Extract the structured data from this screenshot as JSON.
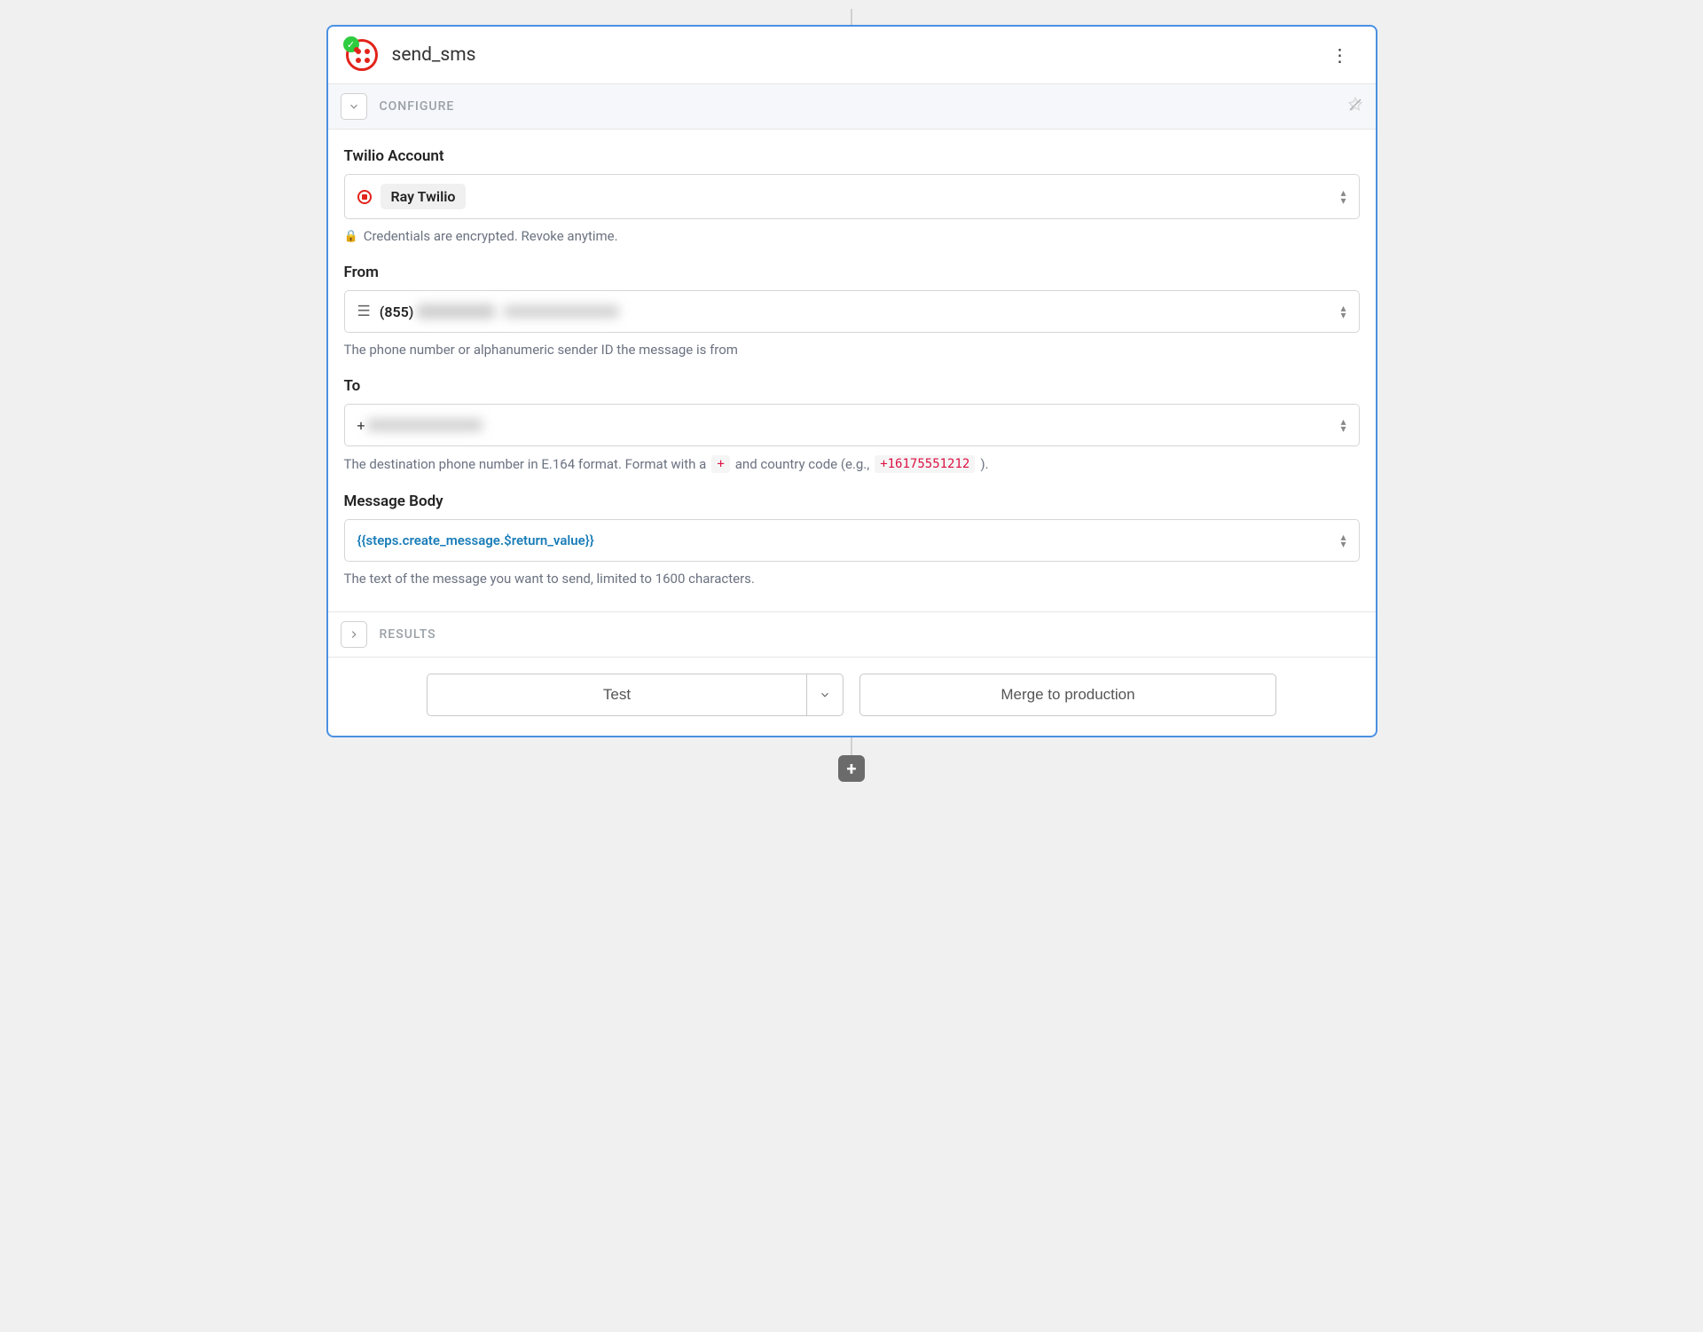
{
  "header": {
    "title": "send_sms"
  },
  "sections": {
    "configure": "CONFIGURE",
    "results": "RESULTS"
  },
  "fields": {
    "account": {
      "label": "Twilio Account",
      "value": "Ray Twilio",
      "helper": "Credentials are encrypted. Revoke anytime."
    },
    "from": {
      "label": "From",
      "prefix": "(855)",
      "helper": "The phone number or alphanumeric sender ID the message is from"
    },
    "to": {
      "label": "To",
      "prefix": "+",
      "helper_pre": "The destination phone number in E.164 format. Format with a",
      "helper_chip1": "+",
      "helper_mid": "and country code (e.g.,",
      "helper_chip2": "+16175551212",
      "helper_post": ")."
    },
    "body": {
      "label": "Message Body",
      "value": "{{steps.create_message.$return_value}}",
      "helper": "The text of the message you want to send, limited to 1600 characters."
    }
  },
  "footer": {
    "test": "Test",
    "merge": "Merge to production"
  }
}
